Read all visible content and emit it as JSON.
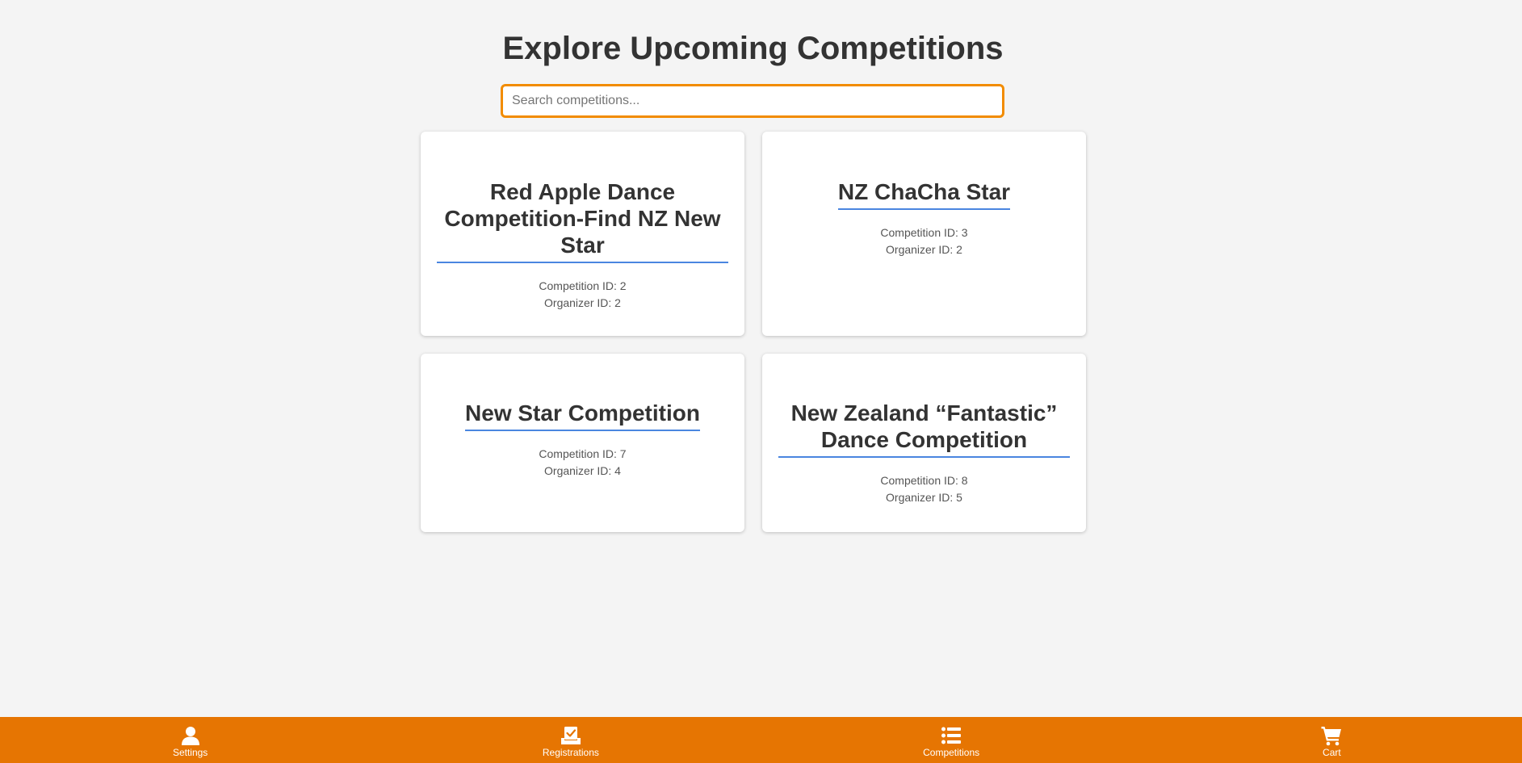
{
  "header": {
    "title": "Explore Upcoming Competitions"
  },
  "search": {
    "placeholder": "Search competitions...",
    "value": ""
  },
  "competitions": [
    {
      "title": "Red Apple Dance Competition-Find NZ New Star",
      "competition_id": "Competition ID: 2",
      "organizer_id": "Organizer ID: 2"
    },
    {
      "title": "NZ ChaCha Star",
      "competition_id": "Competition ID: 3",
      "organizer_id": "Organizer ID: 2"
    },
    {
      "title": "New Star Competition",
      "competition_id": "Competition ID: 7",
      "organizer_id": "Organizer ID: 4"
    },
    {
      "title": "New Zealand “Fantastic” Dance Competition",
      "competition_id": "Competition ID: 8",
      "organizer_id": "Organizer ID: 5"
    }
  ],
  "bottom_nav": {
    "items": [
      {
        "label": "Settings",
        "icon": "user-icon"
      },
      {
        "label": "Registrations",
        "icon": "registration-icon"
      },
      {
        "label": "Competitions",
        "icon": "list-icon"
      },
      {
        "label": "Cart",
        "icon": "cart-icon"
      }
    ]
  },
  "colors": {
    "accent": "#e67502",
    "search_border": "#f28c00",
    "title_underline": "#4a86e0",
    "background": "#f4f4f4"
  }
}
